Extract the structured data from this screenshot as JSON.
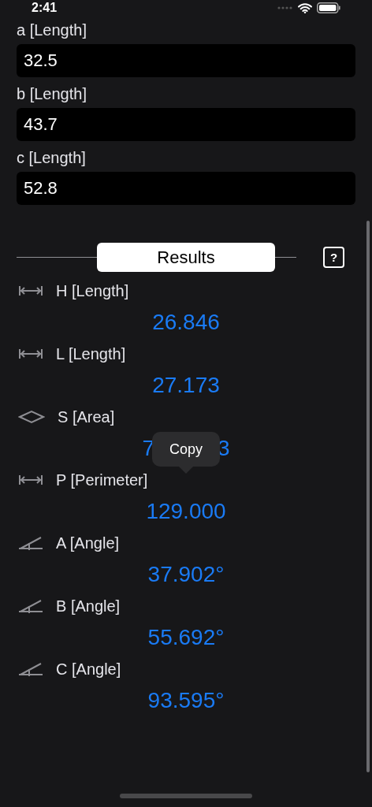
{
  "status_bar": {
    "time": "2:41"
  },
  "inputs": [
    {
      "label": "a [Length]",
      "value": "32.5"
    },
    {
      "label": "b [Length]",
      "value": "43.7"
    },
    {
      "label": "c [Length]",
      "value": "52.8"
    }
  ],
  "results_header": {
    "title": "Results",
    "help": "?"
  },
  "results": [
    {
      "kind": "length",
      "label": "H [Length]",
      "value": "26.846"
    },
    {
      "kind": "length",
      "label": "L [Length]",
      "value": "27.173"
    },
    {
      "kind": "area",
      "label": "S [Area]",
      "value_parts": [
        "7",
        "3"
      ],
      "tooltip": "Copy"
    },
    {
      "kind": "length",
      "label": "P [Perimeter]",
      "value": "129.000"
    },
    {
      "kind": "angle",
      "label": "A [Angle]",
      "value": "37.902°"
    },
    {
      "kind": "angle",
      "label": "B [Angle]",
      "value": "55.692°"
    },
    {
      "kind": "angle",
      "label": "C [Angle]",
      "value": "93.595°"
    }
  ]
}
